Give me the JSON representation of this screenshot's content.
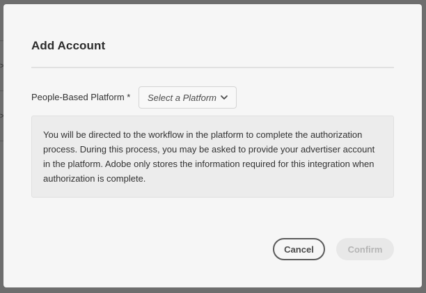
{
  "background": {
    "chevrons": [
      ">",
      ">"
    ]
  },
  "dialog": {
    "title": "Add Account",
    "field_label": "People-Based Platform *",
    "platform_select": {
      "placeholder": "Select a Platform",
      "icon": "chevron-down-icon"
    },
    "info_text": "You will be directed to the workflow in the platform to complete the authorization process. During this process, you may be asked to provide your advertiser account in the platform. Adobe only stores the information required for this integration when authorization is complete.",
    "buttons": {
      "cancel_label": "Cancel",
      "confirm_label": "Confirm",
      "confirm_disabled": true
    }
  },
  "colors": {
    "overlay": "#6e6e6e",
    "dialog_bg": "#f6f6f6",
    "info_bg": "#ececec",
    "disabled_button_bg": "#e8e8e8",
    "disabled_button_text": "#b5b5b5"
  }
}
